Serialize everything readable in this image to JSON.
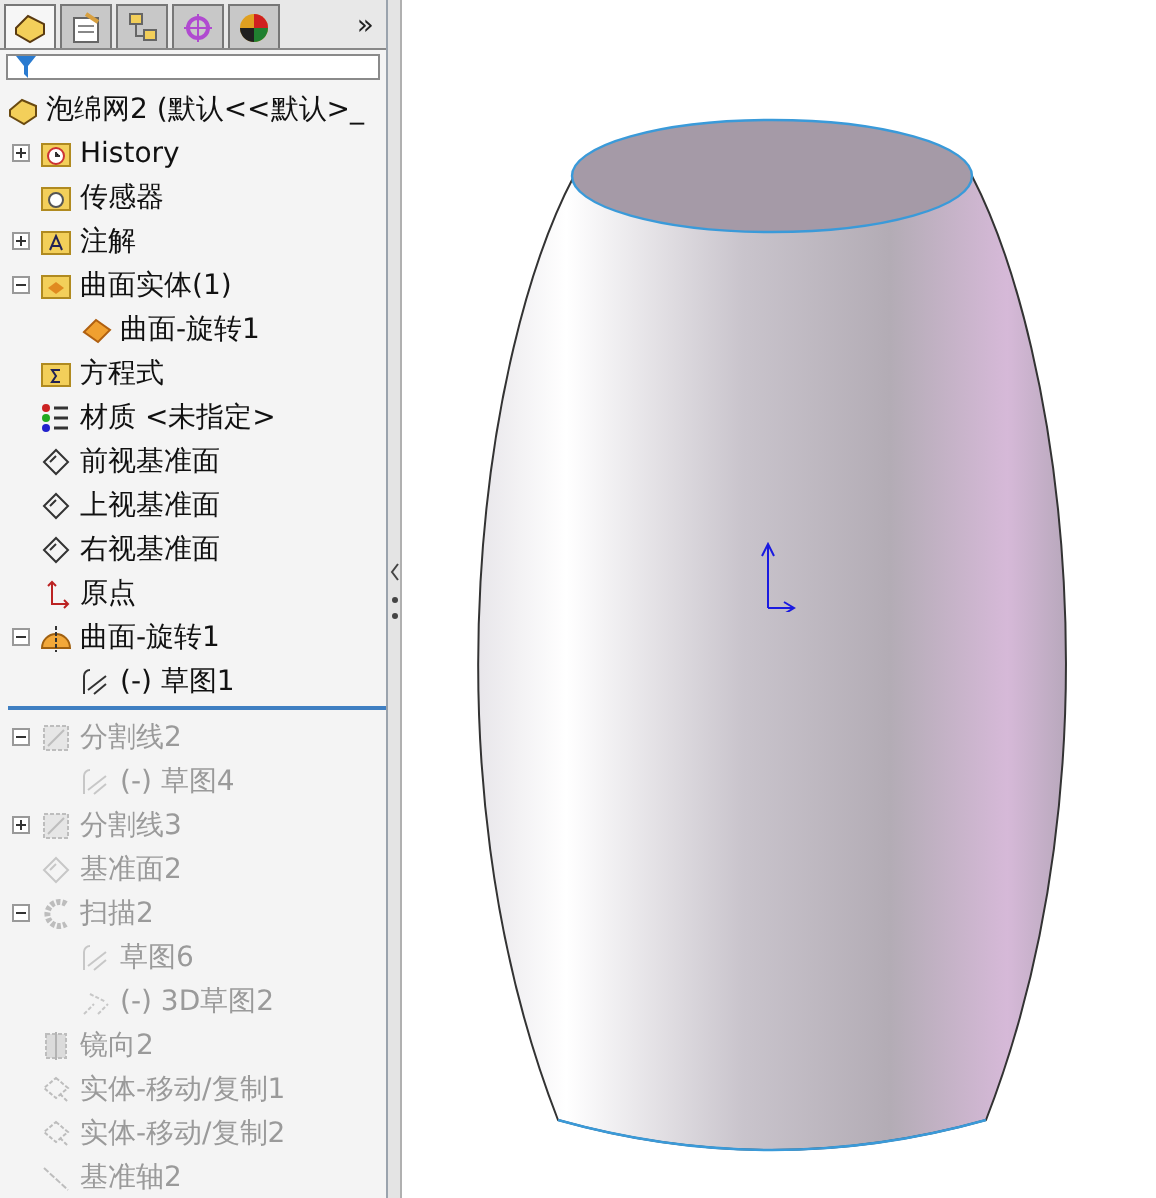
{
  "tabs": [
    {
      "kind": "feature-manager",
      "selected": true
    },
    {
      "kind": "property-manager",
      "selected": false
    },
    {
      "kind": "configuration-manager",
      "selected": false
    },
    {
      "kind": "dim-expert",
      "selected": false
    },
    {
      "kind": "display-manager",
      "selected": false
    }
  ],
  "tabs_more": "»",
  "tree": {
    "root": {
      "label": "泡绵网2  (默认<<默认>_",
      "kind": "part"
    },
    "items": [
      {
        "kind": "history",
        "label": "History",
        "suppressed": false,
        "expanded": false
      },
      {
        "kind": "sensor",
        "label": "传感器",
        "suppressed": false
      },
      {
        "kind": "annotation",
        "label": "注解",
        "suppressed": false,
        "expanded": false
      },
      {
        "kind": "body-folder",
        "label": "曲面实体(1)",
        "suppressed": false,
        "expanded": true,
        "children": [
          {
            "kind": "surface-body",
            "label": "曲面-旋转1",
            "suppressed": false
          }
        ]
      },
      {
        "kind": "equations",
        "label": "方程式",
        "suppressed": false
      },
      {
        "kind": "material",
        "label": "材质 <未指定>",
        "suppressed": false
      },
      {
        "kind": "plane",
        "label": "前视基准面",
        "suppressed": false
      },
      {
        "kind": "plane",
        "label": "上视基准面",
        "suppressed": false
      },
      {
        "kind": "plane",
        "label": "右视基准面",
        "suppressed": false
      },
      {
        "kind": "origin",
        "label": "原点",
        "suppressed": false
      },
      {
        "kind": "revolve",
        "label": "曲面-旋转1",
        "suppressed": false,
        "expanded": true,
        "children": [
          {
            "kind": "sketch",
            "label": "(-) 草图1",
            "suppressed": false
          }
        ]
      },
      {
        "kind": "rollback-bar"
      },
      {
        "kind": "split-line",
        "label": "分割线2",
        "suppressed": true,
        "expanded": true,
        "children": [
          {
            "kind": "sketch",
            "label": "(-) 草图4",
            "suppressed": true
          }
        ]
      },
      {
        "kind": "split-line",
        "label": "分割线3",
        "suppressed": true,
        "expanded": false
      },
      {
        "kind": "plane",
        "label": "基准面2",
        "suppressed": true
      },
      {
        "kind": "sweep",
        "label": "扫描2",
        "suppressed": true,
        "expanded": true,
        "children": [
          {
            "kind": "sketch",
            "label": "草图6",
            "suppressed": true
          },
          {
            "kind": "sketch-3d",
            "label": "(-) 3D草图2",
            "suppressed": true
          }
        ]
      },
      {
        "kind": "mirror",
        "label": "镜向2",
        "suppressed": true
      },
      {
        "kind": "move",
        "label": "实体-移动/复制1",
        "suppressed": true
      },
      {
        "kind": "move",
        "label": "实体-移动/复制2",
        "suppressed": true
      },
      {
        "kind": "axis",
        "label": "基准轴2",
        "suppressed": true
      }
    ]
  }
}
